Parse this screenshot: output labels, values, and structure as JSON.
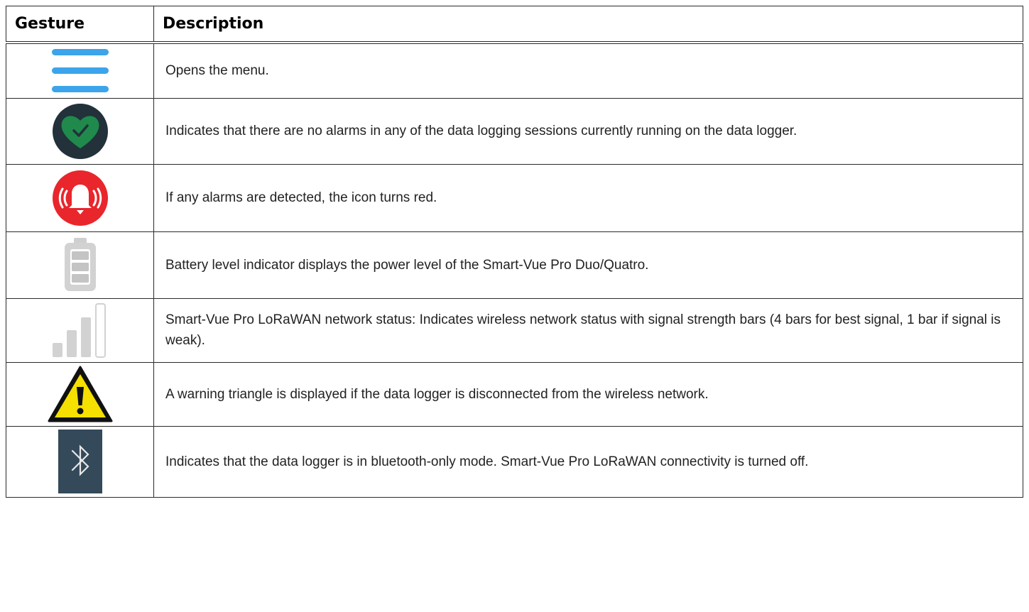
{
  "table": {
    "headers": {
      "gesture": "Gesture",
      "description": "Description"
    },
    "rows": [
      {
        "icon": "menu-hamburger-icon",
        "description": "Opens the menu."
      },
      {
        "icon": "heart-check-status-icon",
        "description": "Indicates that there are no alarms in any of the data logging sessions currently running on the data logger."
      },
      {
        "icon": "alarm-bell-icon",
        "description": "If any alarms are detected, the icon turns red."
      },
      {
        "icon": "battery-level-icon",
        "description": "Battery level indicator displays the power level of the Smart-Vue Pro Duo/Quatro."
      },
      {
        "icon": "signal-strength-icon",
        "description": "Smart-Vue Pro LoRaWAN network status: Indicates wireless network status with signal strength bars (4 bars for best signal, 1 bar if signal is weak)."
      },
      {
        "icon": "warning-triangle-icon",
        "description": "A warning triangle is displayed if the data logger is disconnected from the wireless network."
      },
      {
        "icon": "bluetooth-icon",
        "description": "Indicates that the data logger is in bluetooth-only mode. Smart-Vue Pro LoRaWAN connectivity is turned off."
      }
    ]
  },
  "colors": {
    "menu_blue": "#3ba4ea",
    "heart_green": "#1f8a4c",
    "alarm_red": "#e8262c",
    "battery_grey": "#cfcfcf",
    "warning_yellow": "#f5e000",
    "bluetooth_bg": "#34495a"
  }
}
